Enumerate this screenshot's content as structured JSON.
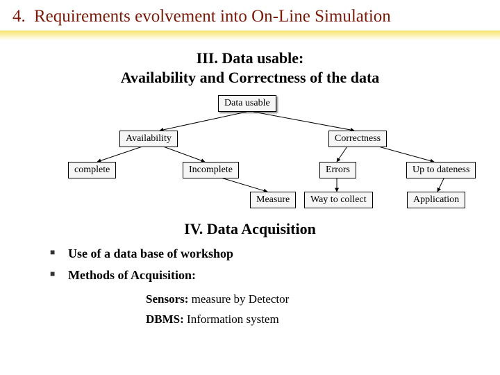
{
  "heading": {
    "number": "4.",
    "title": "Requirements evolvement into On-Line Simulation"
  },
  "section3": {
    "title_line1": "III. Data usable:",
    "title_line2": "Availability and Correctness of the data"
  },
  "nodes": {
    "root": "Data usable",
    "availability": "Availability",
    "correctness": "Correctness",
    "complete": "complete",
    "incomplete": "Incomplete",
    "errors": "Errors",
    "uptodateness": "Up to dateness",
    "measure": "Measure",
    "waycollect": "Way to collect",
    "application": "Application"
  },
  "section4": {
    "title": "IV. Data Acquisition"
  },
  "bullets": {
    "b1": "Use of a data base of workshop",
    "b2": "Methods of Acquisition:"
  },
  "sub": {
    "sensors_lead": "Sensors: ",
    "sensors_text": "measure by Detector",
    "dbms_lead": "DBMS: ",
    "dbms_text": "Information system"
  }
}
